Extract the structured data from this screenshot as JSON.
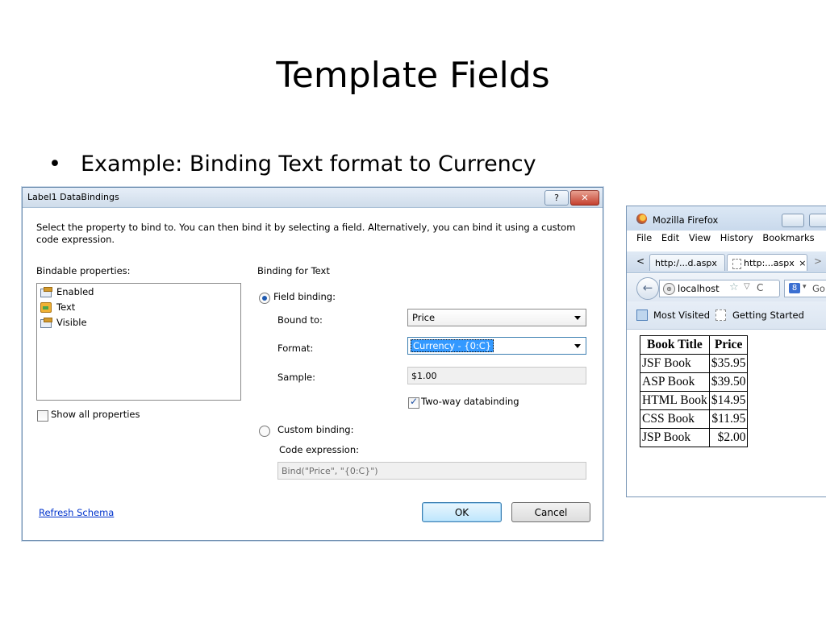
{
  "slide": {
    "title": "Template Fields",
    "bullet": "Example: Binding Text format to Currency",
    "bullet_glyph": "•"
  },
  "dialog": {
    "title": "Label1 DataBindings",
    "help_label": "?",
    "close_label": "✕",
    "instructions": "Select the property to bind to. You can then bind it by selecting a field. Alternatively, you can bind it using a custom code expression.",
    "bindable_label": "Bindable properties:",
    "bindable_items": [
      {
        "label": "Enabled",
        "icon": "property-icon"
      },
      {
        "label": "Text",
        "icon": "text-property-icon"
      },
      {
        "label": "Visible",
        "icon": "property-icon"
      }
    ],
    "show_all_label": "Show all properties",
    "show_all_checked": false,
    "binding_for_label": "Binding for Text",
    "field_binding_label": "Field binding:",
    "field_binding_selected": true,
    "bound_to_label": "Bound to:",
    "bound_to_value": "Price",
    "format_label": "Format:",
    "format_value": "Currency - {0:C}",
    "sample_label": "Sample:",
    "sample_value": "$1.00",
    "two_way_label": "Two-way databinding",
    "two_way_checked": true,
    "custom_binding_label": "Custom binding:",
    "custom_binding_selected": false,
    "code_expression_label": "Code expression:",
    "code_expression_value": "Bind(\"Price\", \"{0:C}\")",
    "refresh_link": "Refresh Schema",
    "ok_label": "OK",
    "cancel_label": "Cancel"
  },
  "firefox": {
    "title": "Mozilla Firefox",
    "menu": [
      "File",
      "Edit",
      "View",
      "History",
      "Bookmarks"
    ],
    "tab_back_arrow": "<",
    "tabs": [
      {
        "label": "http:/...d.aspx"
      },
      {
        "label": "http:...aspx"
      }
    ],
    "tab_close": "×",
    "tab_forward_arrow": ">",
    "back_arrow": "←",
    "url": "localhost",
    "search_engine": "8",
    "search_text": "Go",
    "bookmarks": [
      "Most Visited",
      "Getting Started"
    ],
    "table": {
      "headers": [
        "Book Title",
        "Price"
      ],
      "rows": [
        [
          "JSF Book",
          "$35.95"
        ],
        [
          "ASP Book",
          "$39.50"
        ],
        [
          "HTML Book",
          "$14.95"
        ],
        [
          "CSS Book",
          "$11.95"
        ],
        [
          "JSP Book",
          "$2.00"
        ]
      ]
    }
  }
}
